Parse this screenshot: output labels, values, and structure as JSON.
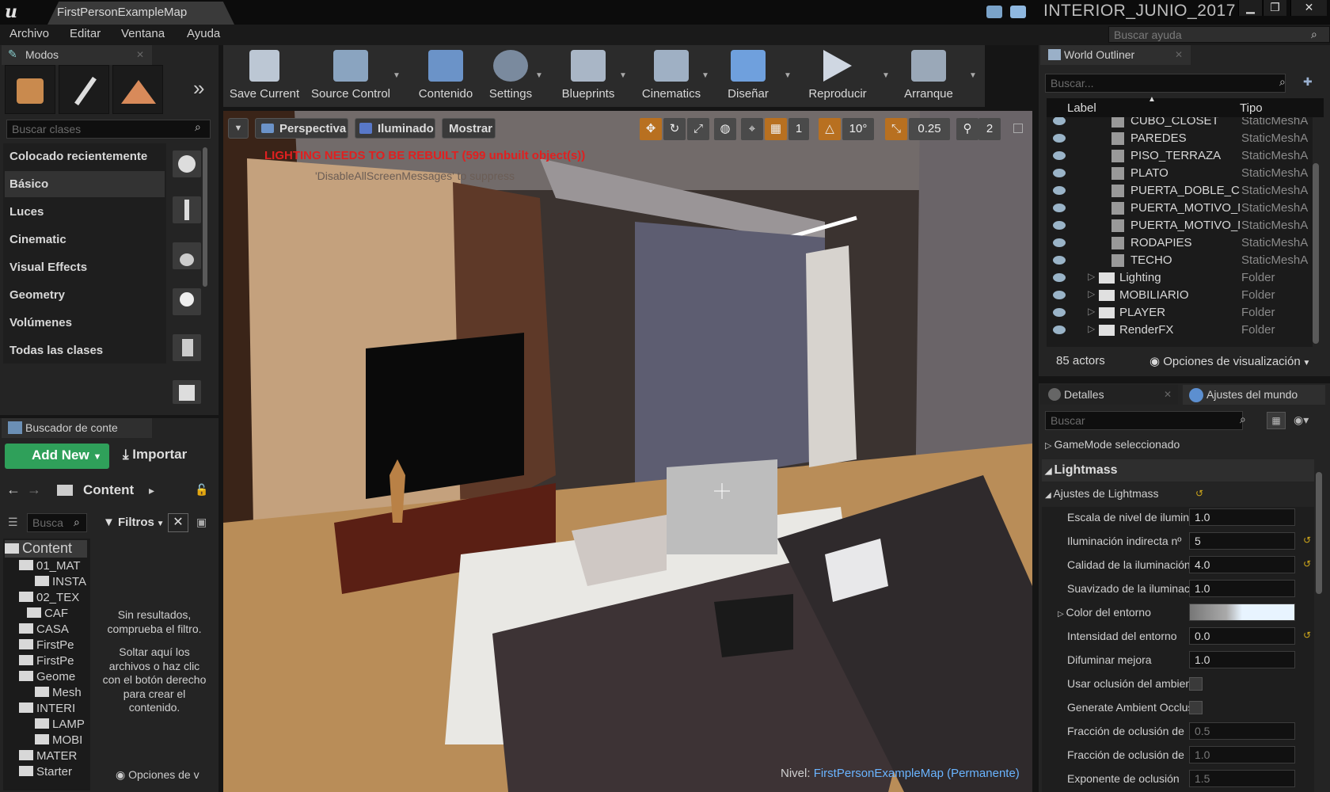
{
  "window": {
    "tab": "FirstPersonExampleMap",
    "project": "INTERIOR_JUNIO_2017",
    "minimize": "▁",
    "maximize": "❐",
    "close": "✕"
  },
  "menu": {
    "items": [
      "Archivo",
      "Editar",
      "Ventana",
      "Ayuda"
    ],
    "help_placeholder": "Buscar ayuda"
  },
  "modes": {
    "tab": "Modos",
    "search_placeholder": "Buscar clases",
    "categories": [
      "Colocado recientemente",
      "Básico",
      "Luces",
      "Cinematic",
      "Visual Effects",
      "Geometry",
      "Volúmenes",
      "Todas las clases"
    ]
  },
  "content": {
    "tab": "Buscador de conte",
    "add_new": "Add New",
    "import": "Importar",
    "path": "Content",
    "search": "Busca",
    "filters": "Filtros",
    "tree": [
      "Content",
      "01_MAT",
      "INSTA",
      "02_TEX",
      "CAF",
      "CASA",
      "FirstPe",
      "FirstPe",
      "Geome",
      "Mesh",
      "INTERI",
      "LAMP",
      "MOBI",
      "MATER",
      "Starter"
    ],
    "empty": [
      "Sin resultados,",
      "comprueba el filtro.",
      "",
      "Soltar aquí los",
      "archivos o haz clic",
      "con el botón derecho",
      "para crear el",
      "contenido."
    ],
    "view_options": "Opciones de v"
  },
  "toolbar": [
    "Save Current",
    "Source Control",
    "Contenido",
    "Settings",
    "Blueprints",
    "Cinematics",
    "Diseñar",
    "Reproducir",
    "Arranque"
  ],
  "viewport": {
    "perspective": "Perspectiva",
    "lit": "Iluminado",
    "show": "Mostrar",
    "rotate_snap": "10°",
    "scale_snap": "0.25",
    "speed": "2",
    "grid": "1",
    "warning": "LIGHTING NEEDS TO BE REBUILT (599 unbuilt object(s))",
    "hint": "'DisableAllScreenMessages' to suppress",
    "level_label": "Nivel:",
    "level_name": "FirstPersonExampleMap (Permanente)"
  },
  "outliner": {
    "tab": "World Outliner",
    "search_placeholder": "Buscar...",
    "col_label": "Label",
    "col_type": "Tipo",
    "rows": [
      {
        "name": "CUBO_CLOSET",
        "type": "StaticMeshA"
      },
      {
        "name": "PAREDES",
        "type": "StaticMeshA"
      },
      {
        "name": "PISO_TERRAZA",
        "type": "StaticMeshA"
      },
      {
        "name": "PLATO",
        "type": "StaticMeshA"
      },
      {
        "name": "PUERTA_DOBLE_CO",
        "type": "StaticMeshA"
      },
      {
        "name": "PUERTA_MOTIVO_M",
        "type": "StaticMeshA"
      },
      {
        "name": "PUERTA_MOTIVO_M",
        "type": "StaticMeshA"
      },
      {
        "name": "RODAPIES",
        "type": "StaticMeshA"
      },
      {
        "name": "TECHO",
        "type": "StaticMeshA"
      },
      {
        "name": "Lighting",
        "type": "Folder"
      },
      {
        "name": "MOBILIARIO",
        "type": "Folder"
      },
      {
        "name": "PLAYER",
        "type": "Folder"
      },
      {
        "name": "RenderFX",
        "type": "Folder"
      }
    ],
    "count": "85 actors",
    "view_options": "Opciones de visualización"
  },
  "details": {
    "tab1": "Detalles",
    "tab2": "Ajustes del mundo",
    "search_placeholder": "Buscar",
    "gamemode": "GameMode seleccionado",
    "section": "Lightmass",
    "subsection": "Ajustes de Lightmass",
    "props": [
      {
        "label": "Escala de nivel de iluminación",
        "value": "1.0"
      },
      {
        "label": "Iluminación indirecta nº",
        "value": "5"
      },
      {
        "label": "Calidad de la iluminación",
        "value": "4.0"
      },
      {
        "label": "Suavizado de la iluminación",
        "value": "1.0"
      },
      {
        "label": "Color del entorno",
        "value": ""
      },
      {
        "label": "Intensidad del entorno",
        "value": "0.0"
      },
      {
        "label": "Difuminar mejora",
        "value": "1.0"
      },
      {
        "label": "Usar oclusión del ambiente",
        "value": ""
      },
      {
        "label": "Generate Ambient Occlusion",
        "value": ""
      },
      {
        "label": "Fracción de oclusión de",
        "value": "0.5"
      },
      {
        "label": "Fracción de oclusión de",
        "value": "1.0"
      },
      {
        "label": "Exponente de oclusión",
        "value": "1.5"
      }
    ]
  }
}
